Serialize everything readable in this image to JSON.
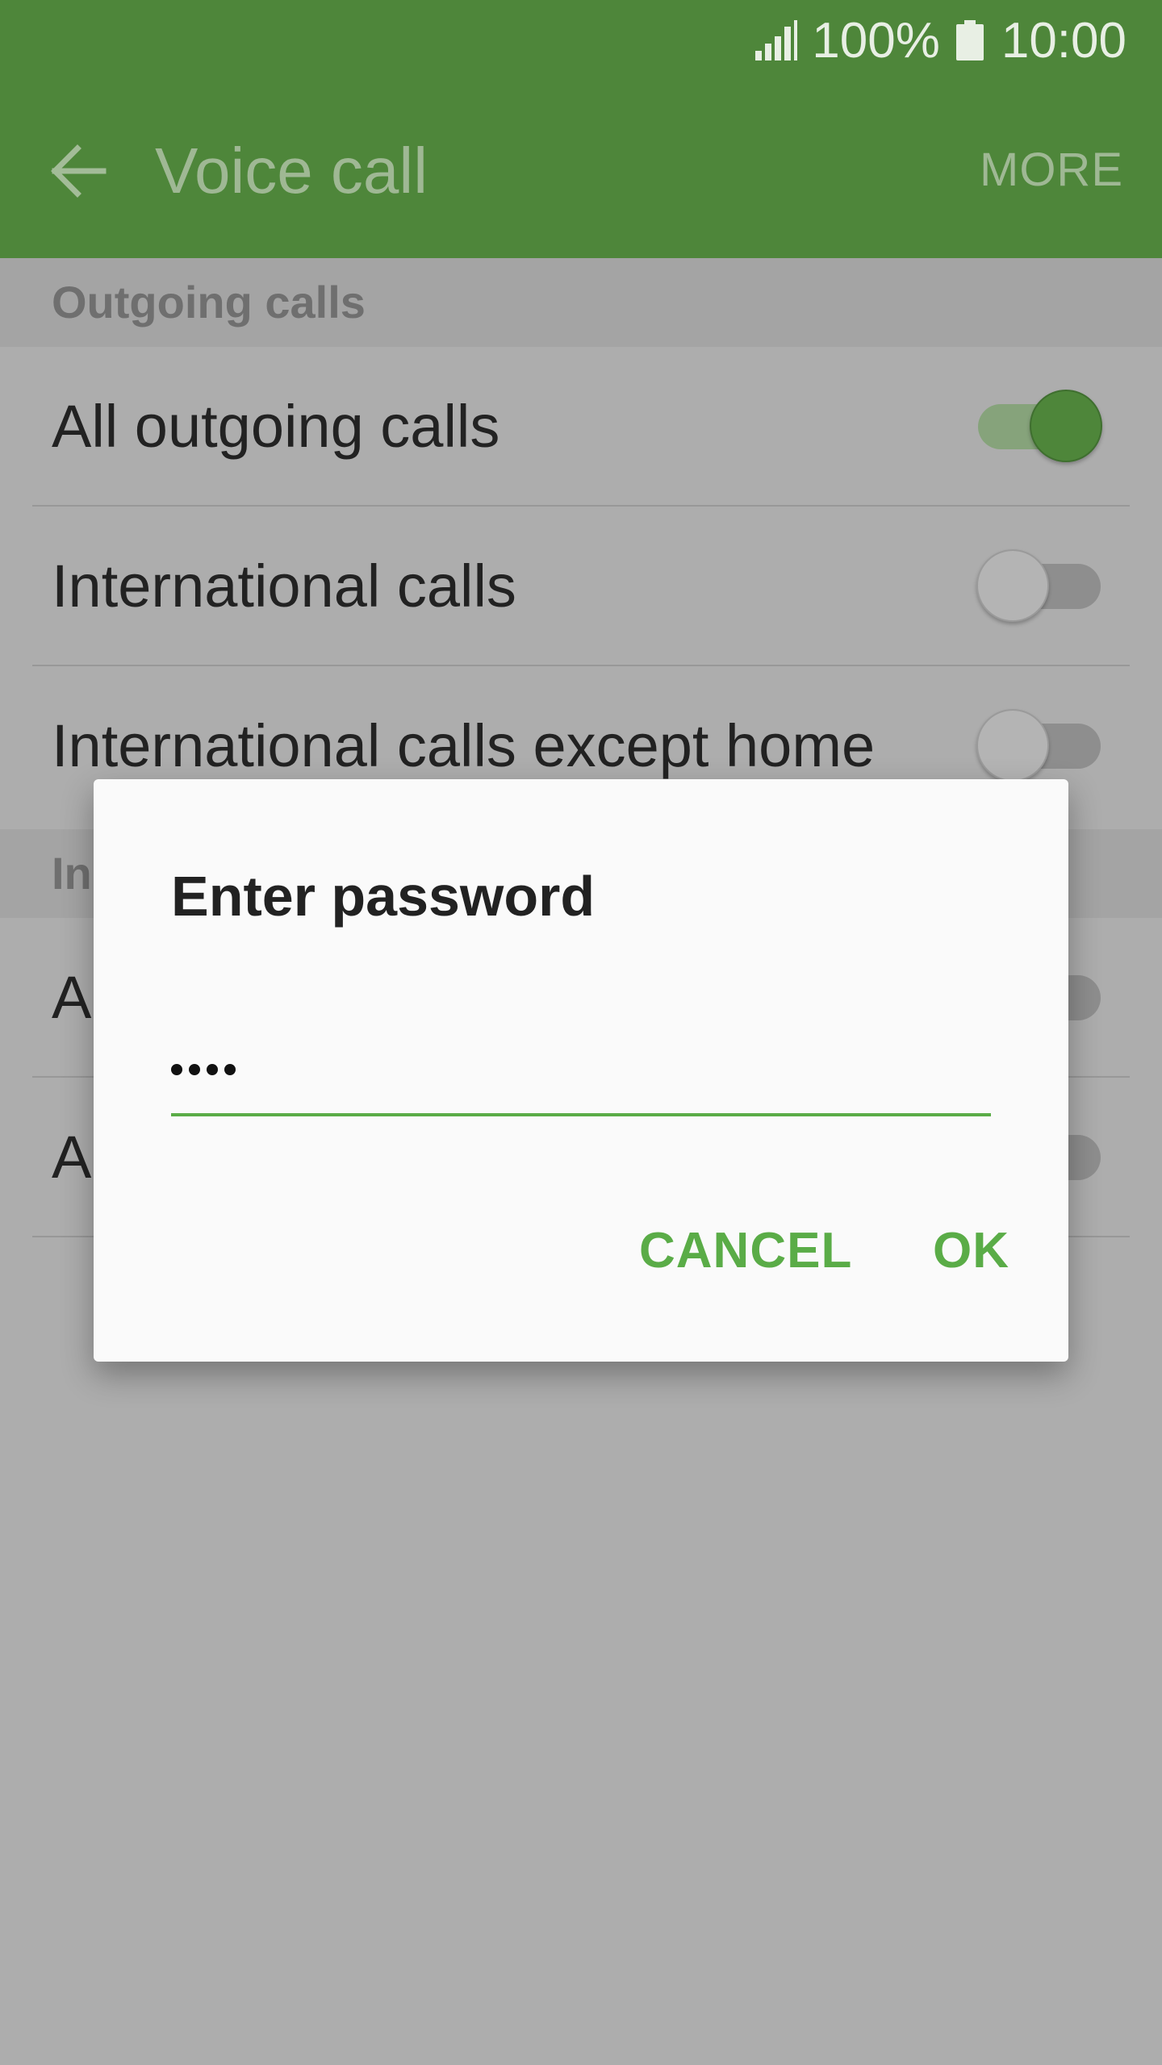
{
  "status_bar": {
    "battery_percent": "100%",
    "time": "10:00",
    "signal_icon": "signal-strength-icon",
    "battery_icon": "battery-full-icon"
  },
  "app_bar": {
    "back_icon": "arrow-back-icon",
    "title": "Voice call",
    "more_label": "MORE",
    "color": "#4e863a"
  },
  "sections": [
    {
      "header": "Outgoing calls",
      "rows": [
        {
          "label": "All outgoing calls",
          "toggle_on": true
        },
        {
          "label": "International calls",
          "toggle_on": false
        },
        {
          "label": "International calls except home",
          "toggle_on": false
        }
      ]
    },
    {
      "header": "In",
      "rows": [
        {
          "label": "A",
          "toggle_on": false
        },
        {
          "label": "A",
          "toggle_on": false
        }
      ]
    }
  ],
  "dialog": {
    "title": "Enter password",
    "password_length": 4,
    "cancel_label": "CANCEL",
    "ok_label": "OK",
    "accent_color": "#5aac47"
  }
}
